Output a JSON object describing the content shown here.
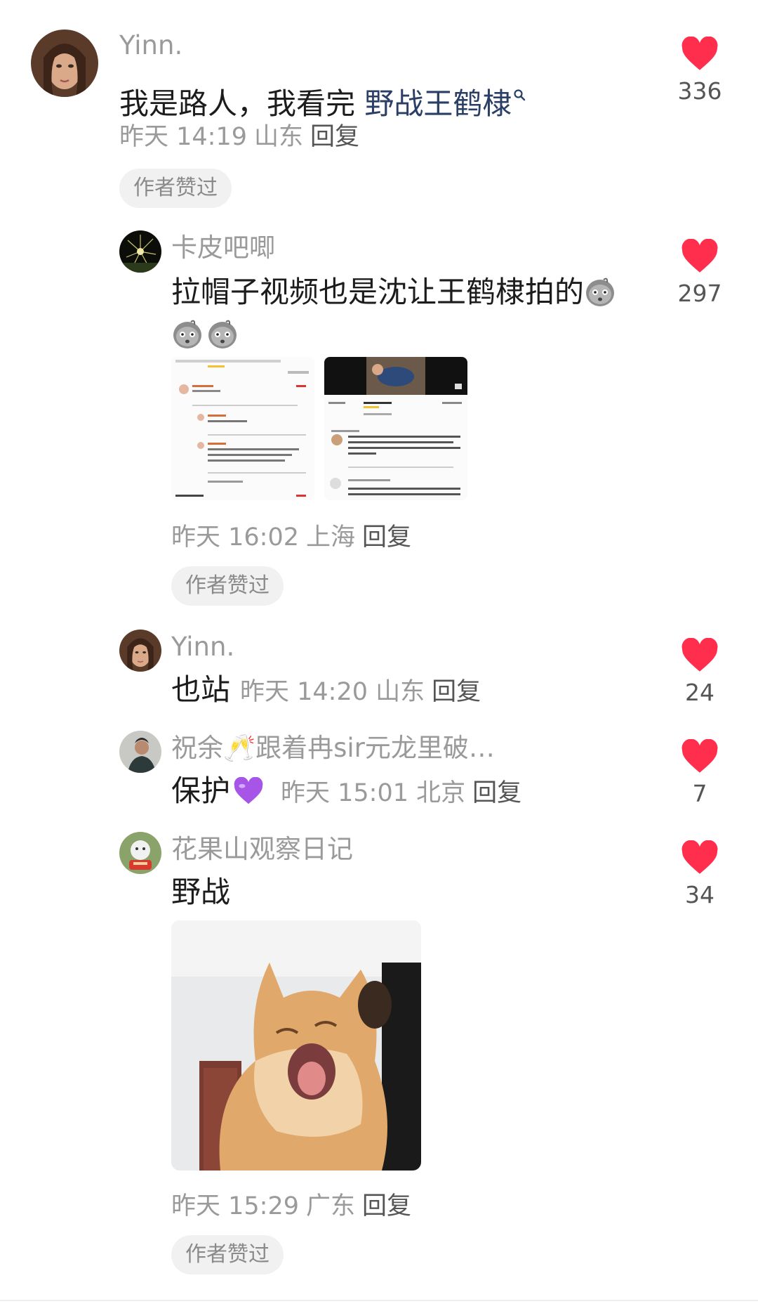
{
  "comments": [
    {
      "username": "Yinn.",
      "text": "我是路人，我看完 ",
      "link_text": "野战王鹤棣",
      "time": "昨天 14:19",
      "location": "山东",
      "reply": "回复",
      "badge": "作者赞过",
      "likes": "336"
    },
    {
      "username": "卡皮吧唧",
      "text": "拉帽子视频也是沈让王鹤棣拍的",
      "time": "昨天 16:02",
      "location": "上海",
      "reply": "回复",
      "badge": "作者赞过",
      "likes": "297"
    },
    {
      "username": "Yinn.",
      "text": "也站",
      "time": "昨天 14:20",
      "location": "山东",
      "reply": "回复",
      "likes": "24"
    },
    {
      "username": "祝余🥂跟着冉sir元龙里破…",
      "text": "保护",
      "time": "昨天 15:01",
      "location": "北京",
      "reply": "回复",
      "likes": "7"
    },
    {
      "username": "花果山观察日记",
      "text": "野战",
      "time": "昨天 15:29",
      "location": "广东",
      "reply": "回复",
      "badge": "作者赞过",
      "likes": "34"
    }
  ],
  "colors": {
    "heart": "#ff2e4d",
    "link": "#2b3f66",
    "muted": "#9a9a9a"
  },
  "icons": {
    "heart": "heart-icon",
    "search": "search-icon",
    "purple_heart": "purple-heart-emoji"
  }
}
